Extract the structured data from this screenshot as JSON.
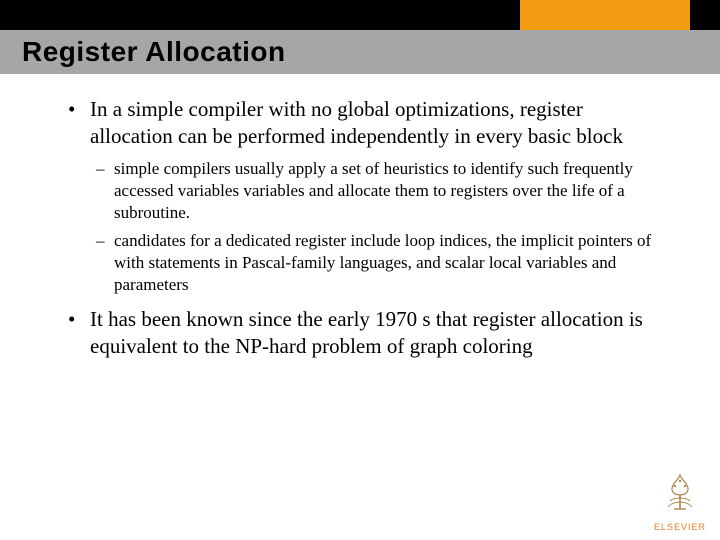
{
  "header": {
    "title": "Register Allocation"
  },
  "bullets": [
    {
      "text": "In a simple compiler with no global optimizations, register allocation can be performed independently in every basic block",
      "sub": [
        "simple compilers usually apply a set of heuristics to identify such frequently accessed variables variables and allocate them to registers over the life of a subroutine.",
        "candidates for a dedicated register include loop indices, the implicit pointers of with statements in Pascal-family languages, and scalar local variables and parameters"
      ]
    },
    {
      "text": "It has been known since the early 1970 s that register allocation is equivalent to the NP-hard problem of graph coloring",
      "sub": []
    }
  ],
  "footer": {
    "publisher": "ELSEVIER"
  }
}
